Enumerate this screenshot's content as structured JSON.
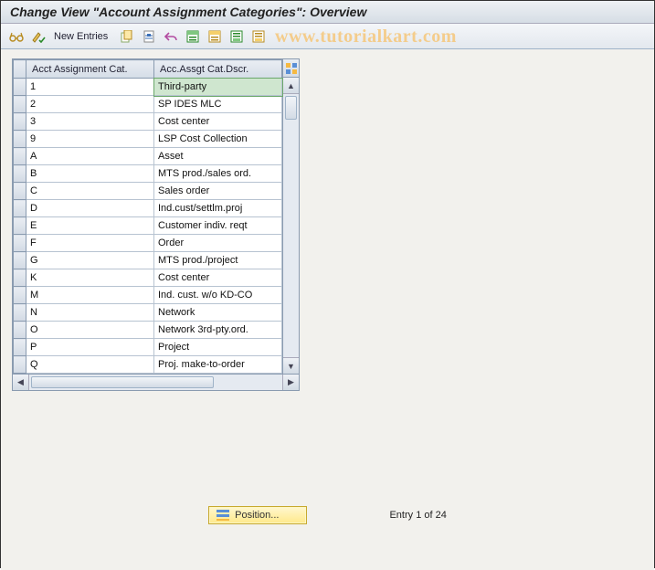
{
  "title": "Change View \"Account Assignment Categories\": Overview",
  "watermark": "www.tutorialkart.com",
  "toolbar": {
    "new_entries": "New Entries"
  },
  "table": {
    "col_cat": "Acct Assignment Cat.",
    "col_desc": "Acc.Assgt Cat.Dscr.",
    "rows": [
      {
        "cat": "1",
        "desc": "Third-party"
      },
      {
        "cat": "2",
        "desc": "SP IDES MLC"
      },
      {
        "cat": "3",
        "desc": "Cost center"
      },
      {
        "cat": "9",
        "desc": "LSP Cost Collection"
      },
      {
        "cat": "A",
        "desc": "Asset"
      },
      {
        "cat": "B",
        "desc": "MTS prod./sales ord."
      },
      {
        "cat": "C",
        "desc": "Sales order"
      },
      {
        "cat": "D",
        "desc": "Ind.cust/settlm.proj"
      },
      {
        "cat": "E",
        "desc": "Customer indiv. reqt"
      },
      {
        "cat": "F",
        "desc": "Order"
      },
      {
        "cat": "G",
        "desc": "MTS prod./project"
      },
      {
        "cat": "K",
        "desc": "Cost center"
      },
      {
        "cat": "M",
        "desc": "Ind. cust. w/o KD-CO"
      },
      {
        "cat": "N",
        "desc": "Network"
      },
      {
        "cat": "O",
        "desc": "Network 3rd-pty.ord."
      },
      {
        "cat": "P",
        "desc": "Project"
      },
      {
        "cat": "Q",
        "desc": "Proj. make-to-order"
      }
    ]
  },
  "footer": {
    "position_label": "Position...",
    "entry_label": "Entry 1 of 24"
  }
}
